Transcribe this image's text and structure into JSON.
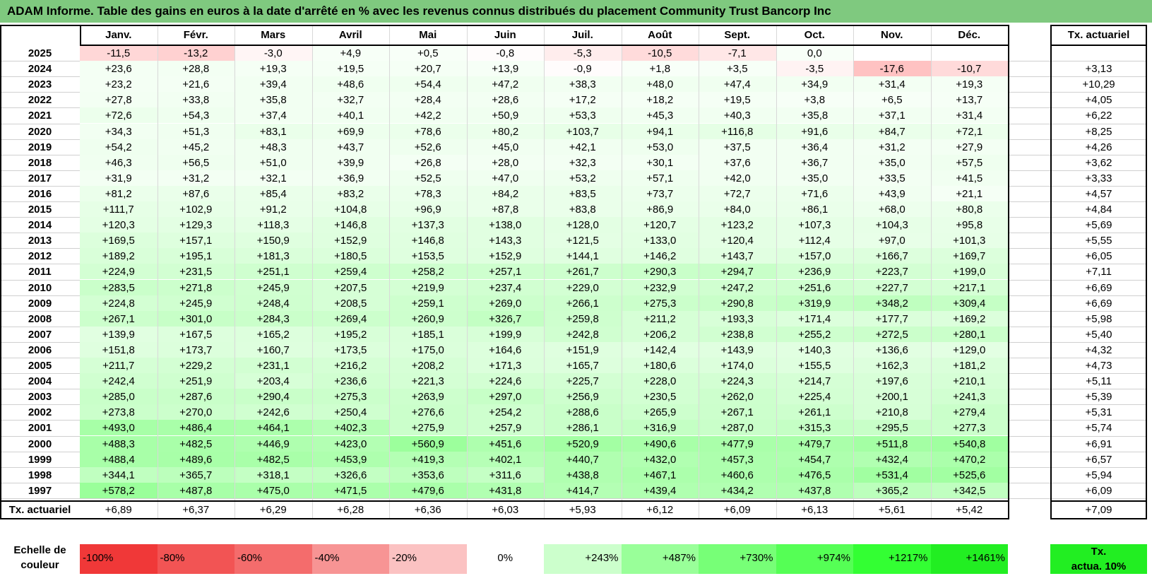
{
  "title": "ADAM Informe. Table des gains en euros à la date d'arrêté en % avec les revenus connus distribués du placement Community Trust Bancorp Inc",
  "chart_data": {
    "type": "table",
    "months": [
      "Janv.",
      "Févr.",
      "Mars",
      "Avril",
      "Mai",
      "Juin",
      "Juil.",
      "Août",
      "Sept.",
      "Oct.",
      "Nov.",
      "Déc."
    ],
    "rate_header": "Tx. actuariel",
    "rows": [
      {
        "year": "2025",
        "values": [
          "-11,5",
          "-13,2",
          "-3,0",
          "+4,9",
          "+0,5",
          "-0,8",
          "-5,3",
          "-10,5",
          "-7,1",
          "0,0",
          "",
          ""
        ],
        "rate": ""
      },
      {
        "year": "2024",
        "values": [
          "+23,6",
          "+28,8",
          "+19,3",
          "+19,5",
          "+20,7",
          "+13,9",
          "-0,9",
          "+1,8",
          "+3,5",
          "-3,5",
          "-17,6",
          "-10,7"
        ],
        "rate": "+3,13"
      },
      {
        "year": "2023",
        "values": [
          "+23,2",
          "+21,6",
          "+39,4",
          "+48,6",
          "+54,4",
          "+47,2",
          "+38,3",
          "+48,0",
          "+47,4",
          "+34,9",
          "+31,4",
          "+19,3"
        ],
        "rate": "+10,29"
      },
      {
        "year": "2022",
        "values": [
          "+27,8",
          "+33,8",
          "+35,8",
          "+32,7",
          "+28,4",
          "+28,6",
          "+17,2",
          "+18,2",
          "+19,5",
          "+3,8",
          "+6,5",
          "+13,7"
        ],
        "rate": "+4,05"
      },
      {
        "year": "2021",
        "values": [
          "+72,6",
          "+54,3",
          "+37,4",
          "+40,1",
          "+42,2",
          "+50,9",
          "+53,3",
          "+45,3",
          "+40,3",
          "+35,8",
          "+37,1",
          "+31,4"
        ],
        "rate": "+6,22"
      },
      {
        "year": "2020",
        "values": [
          "+34,3",
          "+51,3",
          "+83,1",
          "+69,9",
          "+78,6",
          "+80,2",
          "+103,7",
          "+94,1",
          "+116,8",
          "+91,6",
          "+84,7",
          "+72,1"
        ],
        "rate": "+8,25"
      },
      {
        "year": "2019",
        "values": [
          "+54,2",
          "+45,2",
          "+48,3",
          "+43,7",
          "+52,6",
          "+45,0",
          "+42,1",
          "+53,0",
          "+37,5",
          "+36,4",
          "+31,2",
          "+27,9"
        ],
        "rate": "+4,26"
      },
      {
        "year": "2018",
        "values": [
          "+46,3",
          "+56,5",
          "+51,0",
          "+39,9",
          "+26,8",
          "+28,0",
          "+32,3",
          "+30,1",
          "+37,6",
          "+36,7",
          "+35,0",
          "+57,5"
        ],
        "rate": "+3,62"
      },
      {
        "year": "2017",
        "values": [
          "+31,9",
          "+31,2",
          "+32,1",
          "+36,9",
          "+52,5",
          "+47,0",
          "+53,2",
          "+57,1",
          "+42,0",
          "+35,0",
          "+33,5",
          "+41,5"
        ],
        "rate": "+3,33"
      },
      {
        "year": "2016",
        "values": [
          "+81,2",
          "+87,6",
          "+85,4",
          "+83,2",
          "+78,3",
          "+84,2",
          "+83,5",
          "+73,7",
          "+72,7",
          "+71,6",
          "+43,9",
          "+21,1"
        ],
        "rate": "+4,57"
      },
      {
        "year": "2015",
        "values": [
          "+111,7",
          "+102,9",
          "+91,2",
          "+104,8",
          "+96,9",
          "+87,8",
          "+83,8",
          "+86,9",
          "+84,0",
          "+86,1",
          "+68,0",
          "+80,8"
        ],
        "rate": "+4,84"
      },
      {
        "year": "2014",
        "values": [
          "+120,3",
          "+129,3",
          "+118,3",
          "+146,8",
          "+137,3",
          "+138,0",
          "+128,0",
          "+120,7",
          "+123,2",
          "+107,3",
          "+104,3",
          "+95,8"
        ],
        "rate": "+5,69"
      },
      {
        "year": "2013",
        "values": [
          "+169,5",
          "+157,1",
          "+150,9",
          "+152,9",
          "+146,8",
          "+143,3",
          "+121,5",
          "+133,0",
          "+120,4",
          "+112,4",
          "+97,0",
          "+101,3"
        ],
        "rate": "+5,55"
      },
      {
        "year": "2012",
        "values": [
          "+189,2",
          "+195,1",
          "+181,3",
          "+180,5",
          "+153,5",
          "+152,9",
          "+144,1",
          "+146,2",
          "+143,7",
          "+157,0",
          "+166,7",
          "+169,7"
        ],
        "rate": "+6,05"
      },
      {
        "year": "2011",
        "values": [
          "+224,9",
          "+231,5",
          "+251,1",
          "+259,4",
          "+258,2",
          "+257,1",
          "+261,7",
          "+290,3",
          "+294,7",
          "+236,9",
          "+223,7",
          "+199,0"
        ],
        "rate": "+7,11"
      },
      {
        "year": "2010",
        "values": [
          "+283,5",
          "+271,8",
          "+245,9",
          "+207,5",
          "+219,9",
          "+237,4",
          "+229,0",
          "+232,9",
          "+247,2",
          "+251,6",
          "+227,7",
          "+217,1"
        ],
        "rate": "+6,69"
      },
      {
        "year": "2009",
        "values": [
          "+224,8",
          "+245,9",
          "+248,4",
          "+208,5",
          "+259,1",
          "+269,0",
          "+266,1",
          "+275,3",
          "+290,8",
          "+319,9",
          "+348,2",
          "+309,4"
        ],
        "rate": "+6,69"
      },
      {
        "year": "2008",
        "values": [
          "+267,1",
          "+301,0",
          "+284,3",
          "+269,4",
          "+260,9",
          "+326,7",
          "+259,8",
          "+211,2",
          "+193,3",
          "+171,4",
          "+177,7",
          "+169,2"
        ],
        "rate": "+5,98"
      },
      {
        "year": "2007",
        "values": [
          "+139,9",
          "+167,5",
          "+165,2",
          "+195,2",
          "+185,1",
          "+199,9",
          "+242,8",
          "+206,2",
          "+238,8",
          "+255,2",
          "+272,5",
          "+280,1"
        ],
        "rate": "+5,40"
      },
      {
        "year": "2006",
        "values": [
          "+151,8",
          "+173,7",
          "+160,7",
          "+173,5",
          "+175,0",
          "+164,6",
          "+151,9",
          "+142,4",
          "+143,9",
          "+140,3",
          "+136,6",
          "+129,0"
        ],
        "rate": "+4,32"
      },
      {
        "year": "2005",
        "values": [
          "+211,7",
          "+229,2",
          "+231,1",
          "+216,2",
          "+208,2",
          "+171,3",
          "+165,7",
          "+180,6",
          "+174,0",
          "+155,5",
          "+162,3",
          "+181,2"
        ],
        "rate": "+4,73"
      },
      {
        "year": "2004",
        "values": [
          "+242,4",
          "+251,9",
          "+203,4",
          "+236,6",
          "+221,3",
          "+224,6",
          "+225,7",
          "+228,0",
          "+224,3",
          "+214,7",
          "+197,6",
          "+210,1"
        ],
        "rate": "+5,11"
      },
      {
        "year": "2003",
        "values": [
          "+285,0",
          "+287,6",
          "+290,4",
          "+275,3",
          "+263,9",
          "+297,0",
          "+256,9",
          "+230,5",
          "+262,0",
          "+225,4",
          "+200,1",
          "+241,3"
        ],
        "rate": "+5,39"
      },
      {
        "year": "2002",
        "values": [
          "+273,8",
          "+270,0",
          "+242,6",
          "+250,4",
          "+276,6",
          "+254,2",
          "+288,6",
          "+265,9",
          "+267,1",
          "+261,1",
          "+210,8",
          "+279,4"
        ],
        "rate": "+5,31"
      },
      {
        "year": "2001",
        "values": [
          "+493,0",
          "+486,4",
          "+464,1",
          "+402,3",
          "+275,9",
          "+257,9",
          "+286,1",
          "+316,9",
          "+287,0",
          "+315,3",
          "+295,5",
          "+277,3"
        ],
        "rate": "+5,74"
      },
      {
        "year": "2000",
        "values": [
          "+488,3",
          "+482,5",
          "+446,9",
          "+423,0",
          "+560,9",
          "+451,6",
          "+520,9",
          "+490,6",
          "+477,9",
          "+479,7",
          "+511,8",
          "+540,8"
        ],
        "rate": "+6,91"
      },
      {
        "year": "1999",
        "values": [
          "+488,4",
          "+489,6",
          "+482,5",
          "+453,9",
          "+419,3",
          "+402,1",
          "+440,7",
          "+432,0",
          "+457,3",
          "+454,7",
          "+432,4",
          "+470,2"
        ],
        "rate": "+6,57"
      },
      {
        "year": "1998",
        "values": [
          "+344,1",
          "+365,7",
          "+318,1",
          "+326,6",
          "+353,6",
          "+311,6",
          "+438,8",
          "+467,1",
          "+460,6",
          "+476,5",
          "+531,4",
          "+525,6"
        ],
        "rate": "+5,94"
      },
      {
        "year": "1997",
        "values": [
          "+578,2",
          "+487,8",
          "+475,0",
          "+471,5",
          "+479,6",
          "+431,8",
          "+414,7",
          "+439,4",
          "+434,2",
          "+437,8",
          "+365,2",
          "+342,5"
        ],
        "rate": "+6,09"
      }
    ],
    "footer": {
      "label": "Tx. actuariel",
      "values": [
        "+6,89",
        "+6,37",
        "+6,29",
        "+6,28",
        "+6,36",
        "+6,03",
        "+5,93",
        "+6,12",
        "+6,09",
        "+6,13",
        "+5,61",
        "+5,42"
      ],
      "rate": "+7,09"
    },
    "legend": {
      "label_line1": "Echelle de",
      "label_line2": "couleur",
      "items": [
        {
          "label": "-100%",
          "color": "#f03838",
          "align": "left"
        },
        {
          "label": "-80%",
          "color": "#f25454",
          "align": "left"
        },
        {
          "label": "-60%",
          "color": "#f46c6c",
          "align": "left"
        },
        {
          "label": "-40%",
          "color": "#f79494",
          "align": "left"
        },
        {
          "label": "-20%",
          "color": "#fbc2c2",
          "align": "left"
        },
        {
          "label": "0%",
          "color": "#ffffff",
          "align": "center"
        },
        {
          "label": "+243%",
          "color": "#ccffcc",
          "align": "right"
        },
        {
          "label": "+487%",
          "color": "#99ff99",
          "align": "right"
        },
        {
          "label": "+730%",
          "color": "#77ff77",
          "align": "right"
        },
        {
          "label": "+974%",
          "color": "#55ff55",
          "align": "right"
        },
        {
          "label": "+1217%",
          "color": "#33ff33",
          "align": "right"
        },
        {
          "label": "+1461%",
          "color": "#22ee22",
          "align": "right"
        }
      ],
      "rate_label_line1": "Tx.",
      "rate_label_line2": "actua. 10%",
      "rate_color": "#22ee22"
    }
  }
}
